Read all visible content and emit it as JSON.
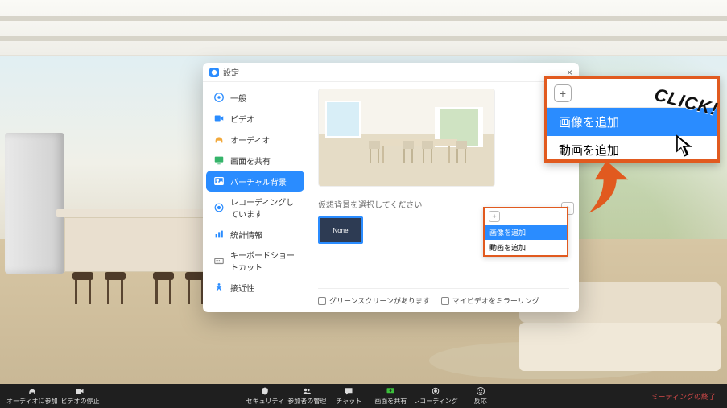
{
  "modal": {
    "title": "設定",
    "close": "×",
    "nav": [
      {
        "key": "general",
        "label": "一般",
        "color": "#2a8cff"
      },
      {
        "key": "video",
        "label": "ビデオ",
        "color": "#2a8cff"
      },
      {
        "key": "audio",
        "label": "オーディオ",
        "color": "#f2a93b"
      },
      {
        "key": "share",
        "label": "画面を共有",
        "color": "#35b46a"
      },
      {
        "key": "vbg",
        "label": "バーチャル背景",
        "color": "#2a8cff"
      },
      {
        "key": "recording",
        "label": "レコーディングしています",
        "color": "#2a8cff"
      },
      {
        "key": "stats",
        "label": "統計情報",
        "color": "#2a8cff"
      },
      {
        "key": "shortcut",
        "label": "キーボードショートカット",
        "color": "#888"
      },
      {
        "key": "access",
        "label": "接近性",
        "color": "#2a8cff"
      }
    ],
    "active_nav": "vbg",
    "instruction": "仮想背景を選択してください",
    "thumbs": {
      "none_label": "None"
    },
    "add_button_glyph": "+",
    "add_menu": {
      "image": "画像を追加",
      "video": "動画を追加"
    },
    "options": {
      "greenscreen": "グリーンスクリーンがあります",
      "mirror": "マイビデオをミラーリング"
    }
  },
  "callout": {
    "menu": {
      "image": "画像を追加",
      "video": "動画を追加"
    },
    "click_label": "CLICK!"
  },
  "toolbar": {
    "left": [
      {
        "key": "audio",
        "label": "オーディオに参加"
      },
      {
        "key": "video",
        "label": "ビデオの停止"
      }
    ],
    "center": [
      {
        "key": "security",
        "label": "セキュリティ"
      },
      {
        "key": "participants",
        "label": "参加者の管理"
      },
      {
        "key": "chat",
        "label": "チャット"
      },
      {
        "key": "share",
        "label": "画面を共有"
      },
      {
        "key": "record",
        "label": "レコーディング"
      },
      {
        "key": "reactions",
        "label": "反応"
      }
    ],
    "end": "ミーティングの終了"
  },
  "colors": {
    "accent": "#2a8cff",
    "callout_border": "#e15a1f",
    "toolbar": "#1f1f1f",
    "end": "#d64a4a"
  }
}
